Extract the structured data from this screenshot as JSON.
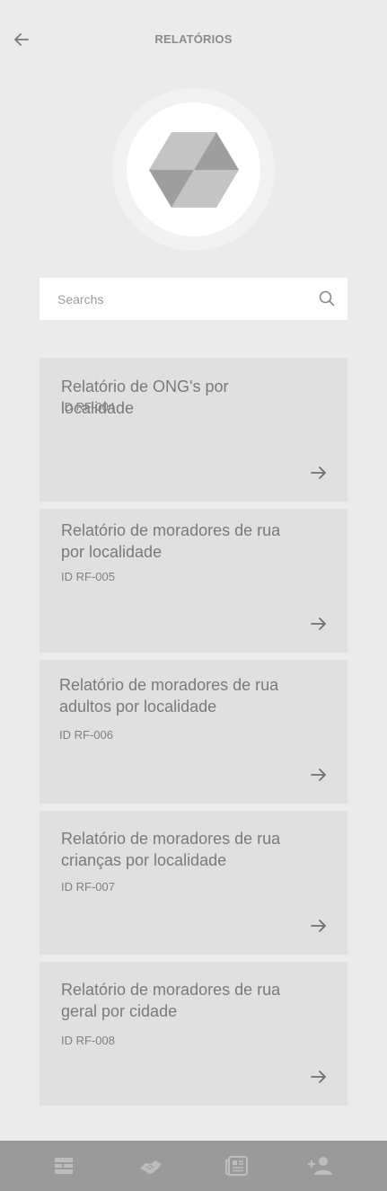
{
  "header": {
    "title": "RELATÓRIOS",
    "back_icon": "arrow-left-icon"
  },
  "logo": {
    "icon": "cube-logo-icon"
  },
  "search": {
    "placeholder": "Searchs",
    "value": "",
    "icon": "search-icon"
  },
  "reports": [
    {
      "title": "Relatório de ONG's por localidade",
      "id": "ID RF-004"
    },
    {
      "title": "Relatório de moradores de rua por localidade",
      "id": "ID RF-005"
    },
    {
      "title": "Relatório de moradores de rua adultos por localidade",
      "id": "ID RF-006"
    },
    {
      "title": "Relatório de moradores de rua crianças por localidade",
      "id": "ID RF-007"
    },
    {
      "title": "Relatório de moradores de rua geral por cidade",
      "id": "ID RF-008"
    }
  ],
  "bottom_nav": {
    "items": [
      {
        "icon": "dashboard-list-icon"
      },
      {
        "icon": "handshake-icon"
      },
      {
        "icon": "newspaper-icon"
      },
      {
        "icon": "add-person-icon"
      }
    ]
  },
  "colors": {
    "background": "#ebebeb",
    "card": "#e0e0e0",
    "nav": "#9a9a9a",
    "text": "#7a7a7a"
  }
}
